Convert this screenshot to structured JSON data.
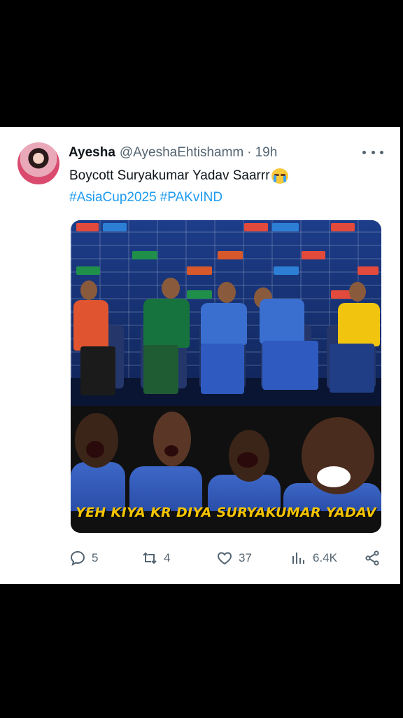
{
  "tweet": {
    "author_name": "Ayesha",
    "handle": "@AyeshaEhtishamm",
    "separator": "·",
    "time": "19h",
    "text": "Boycott Suryakumar Yadav Saarrr",
    "hashtags": [
      "#AsiaCup2025",
      "#PAKvIND"
    ],
    "media_caption": "YEH KIYA KR DIYA SURYAKUMAR YADAV",
    "actions": {
      "replies": "5",
      "reposts": "4",
      "likes": "37",
      "views": "6.4K"
    }
  },
  "icons": {
    "more": "more-horizontal-icon",
    "reply": "reply-icon",
    "repost": "repost-icon",
    "like": "heart-icon",
    "views": "views-icon",
    "share": "share-icon",
    "emoji": "crying-face-emoji"
  },
  "colors": {
    "link": "#1d9bf0",
    "text": "#0f1419",
    "muted": "#536471",
    "caption": "#f5c400"
  }
}
